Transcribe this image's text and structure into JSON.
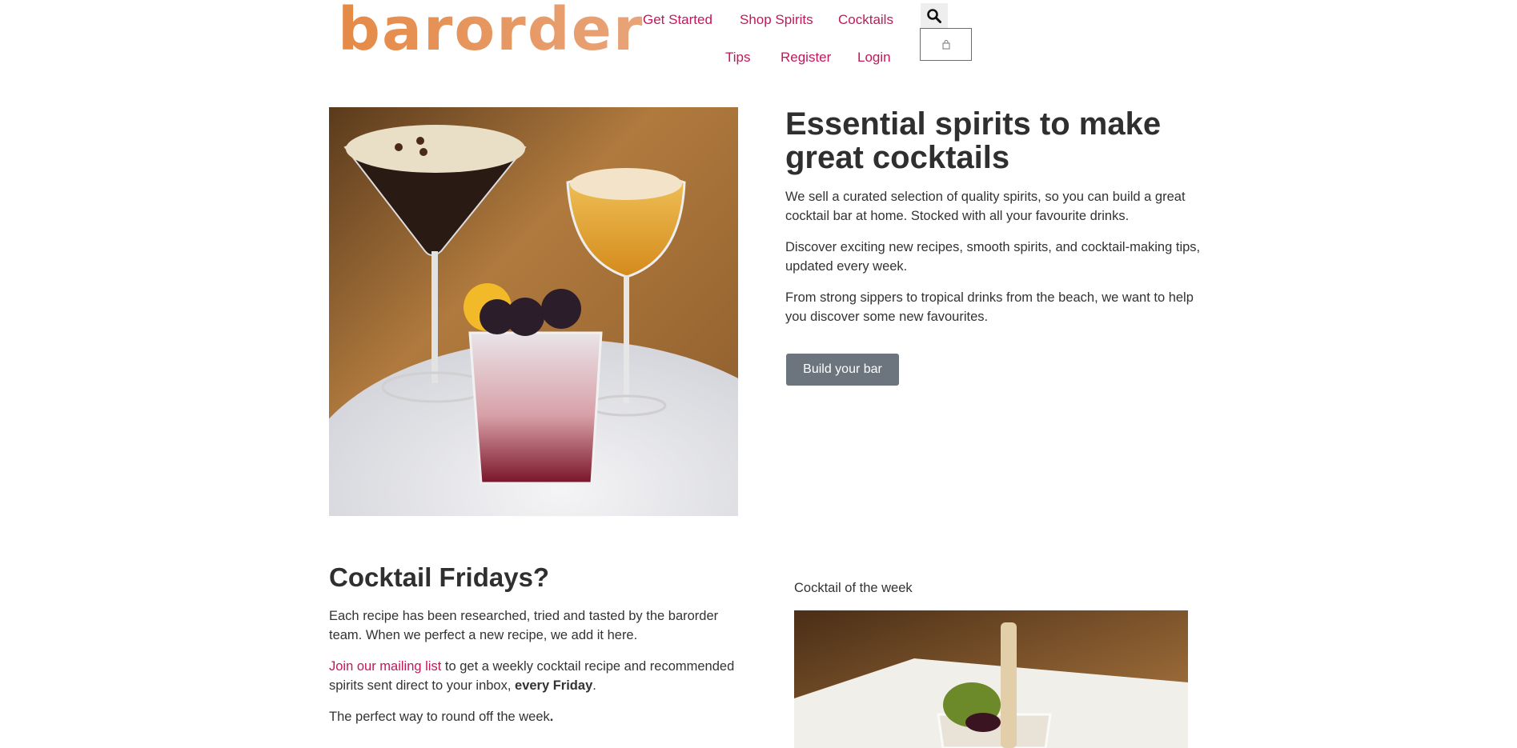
{
  "brand": {
    "logo_text": "barorder",
    "accent": "#c2185b",
    "logo_color": "#e58a46"
  },
  "nav": {
    "row1": [
      "Get Started",
      "Shop Spirits",
      "Cocktails"
    ],
    "row2": [
      "Tips",
      "Register",
      "Login"
    ],
    "search_icon": "search-icon",
    "cart_icon": "shopping-bag-icon"
  },
  "hero": {
    "title": "Essential spirits to make great cocktails",
    "paragraphs": [
      "We sell a curated selection of quality spirits, so you can build a great cocktail bar at home. Stocked with all your favourite drinks.",
      "Discover exciting new recipes, smooth spirits, and cocktail-making tips, updated every week.",
      "From strong sippers to tropical drinks from the beach, we want to help you discover some new favourites."
    ],
    "button_label": "Build your bar",
    "button_color": "#6c757d"
  },
  "fridays": {
    "title": "Cocktail Fridays?",
    "p1": "Each recipe has been researched, tried and tasted by the barorder team. When we perfect a new recipe, we add it here.",
    "p2_link": "Join our mailing list",
    "p2_text": " to get a weekly cocktail recipe and recommended spirits sent direct to your inbox, ",
    "p2_bold": "every Friday",
    "p2_end": ".",
    "p3_text": "The perfect way to round off the week",
    "p3_bold": "."
  },
  "cocktail_of_week": {
    "label": "Cocktail of the week"
  }
}
